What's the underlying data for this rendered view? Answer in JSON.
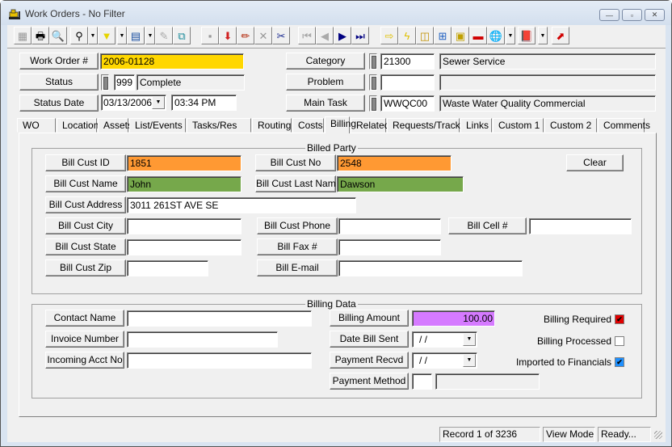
{
  "window": {
    "title": "Work Orders - No Filter",
    "minimize_glyph": "—",
    "maximize_glyph": "▫",
    "close_glyph": "✕"
  },
  "toolbar": {
    "buttons": [
      {
        "name": "blank-view",
        "glyph": "▦",
        "color": "#999999",
        "enabled": false
      },
      {
        "name": "print",
        "glyph": "🖶",
        "color": "#000000",
        "enabled": true
      },
      {
        "name": "print-preview",
        "glyph": "🔍",
        "color": "#000000",
        "enabled": true
      },
      {
        "name": "search",
        "glyph": "⚲",
        "color": "#000000",
        "enabled": true,
        "has_dropdown": true
      },
      {
        "name": "filter",
        "glyph": "▼",
        "color": "#e6d400",
        "enabled": true,
        "has_dropdown": true
      },
      {
        "name": "report",
        "glyph": "▤",
        "color": "#1a4fa0",
        "enabled": true,
        "has_dropdown": true
      },
      {
        "name": "edit-form",
        "glyph": "✎",
        "color": "#aaaaaa",
        "enabled": false
      },
      {
        "name": "copy-document",
        "glyph": "⧉",
        "color": "#1a8a9a",
        "enabled": true
      },
      {
        "name": "save",
        "glyph": "▪",
        "color": "#999999",
        "enabled": false
      },
      {
        "name": "add-record",
        "glyph": "⬇",
        "color": "#d02020",
        "enabled": true
      },
      {
        "name": "edit",
        "glyph": "✏",
        "color": "#b02000",
        "enabled": true
      },
      {
        "name": "delete",
        "glyph": "✕",
        "color": "#999999",
        "enabled": false
      },
      {
        "name": "cut",
        "glyph": "✂",
        "color": "#1a2a90",
        "enabled": true
      },
      {
        "name": "first-record",
        "glyph": "⏮",
        "color": "#aaaaaa",
        "enabled": false
      },
      {
        "name": "previous-record",
        "glyph": "◀",
        "color": "#aaaaaa",
        "enabled": false
      },
      {
        "name": "next-record",
        "glyph": "▶",
        "color": "#000080",
        "enabled": true
      },
      {
        "name": "last-record",
        "glyph": "⏭",
        "color": "#000080",
        "enabled": true
      },
      {
        "name": "go-to",
        "glyph": "⇨",
        "color": "#e0c000",
        "enabled": true
      },
      {
        "name": "quick-action",
        "glyph": "ϟ",
        "color": "#e0c000",
        "enabled": true
      },
      {
        "name": "map",
        "glyph": "◫",
        "color": "#c09000",
        "enabled": true
      },
      {
        "name": "workflow",
        "glyph": "⊞",
        "color": "#2060c0",
        "enabled": true
      },
      {
        "name": "equipment",
        "glyph": "▣",
        "color": "#c0a000",
        "enabled": true
      },
      {
        "name": "toolbox",
        "glyph": "▬",
        "color": "#d00000",
        "enabled": true
      },
      {
        "name": "globe-search",
        "glyph": "🌐",
        "color": "#1a6ab0",
        "enabled": true,
        "has_dropdown": true
      },
      {
        "name": "book",
        "glyph": "📕",
        "color": "#8a3aa0",
        "enabled": true,
        "has_dropdown": true
      },
      {
        "name": "exit",
        "glyph": "⬈",
        "color": "#d00000",
        "enabled": true
      }
    ]
  },
  "header": {
    "work_order": {
      "label": "Work Order #",
      "value": "2006-01128",
      "color": "#ffd700"
    },
    "status": {
      "label": "Status",
      "code": "999",
      "description": "Complete"
    },
    "status_date": {
      "label": "Status Date",
      "date": "03/13/2006",
      "time": "03:34 PM"
    },
    "category": {
      "label": "Category",
      "code": "21300",
      "description": "Sewer Service"
    },
    "problem": {
      "label": "Problem",
      "code": "",
      "description": ""
    },
    "main_task": {
      "label": "Main Task",
      "code": "WWQC00",
      "description": "Waste Water Quality Commercial"
    }
  },
  "tabs": [
    {
      "label": "WO",
      "active": false
    },
    {
      "label": "Location",
      "active": false
    },
    {
      "label": "Assets",
      "active": false
    },
    {
      "label": "List/Events",
      "active": false
    },
    {
      "label": "Tasks/Res",
      "active": false
    },
    {
      "label": "Routing",
      "active": false
    },
    {
      "label": "Costs",
      "active": false
    },
    {
      "label": "Billing",
      "active": true
    },
    {
      "label": "Related",
      "active": false
    },
    {
      "label": "Requests/Track",
      "active": false
    },
    {
      "label": "Links",
      "active": false
    },
    {
      "label": "Custom 1",
      "active": false
    },
    {
      "label": "Custom 2",
      "active": false
    },
    {
      "label": "Comments",
      "active": false
    }
  ],
  "billed_party": {
    "title": "Billed Party",
    "clear_label": "Clear",
    "bill_cust_id": {
      "label": "Bill Cust ID",
      "value": "1851",
      "color": "#ff9933"
    },
    "bill_cust_no": {
      "label": "Bill Cust No",
      "value": "2548",
      "color": "#ff9933"
    },
    "bill_cust_name": {
      "label": "Bill Cust Name",
      "value": "John",
      "color": "#76a84b"
    },
    "bill_cust_last_name": {
      "label": "Bill Cust Last Name",
      "value": "Dawson",
      "color": "#76a84b"
    },
    "bill_cust_address": {
      "label": "Bill Cust Address",
      "value": "3011 261ST AVE SE"
    },
    "bill_cust_city": {
      "label": "Bill Cust City",
      "value": ""
    },
    "bill_cust_state": {
      "label": "Bill Cust State",
      "value": ""
    },
    "bill_cust_zip": {
      "label": "Bill Cust Zip",
      "value": ""
    },
    "bill_cust_phone": {
      "label": "Bill Cust Phone",
      "value": ""
    },
    "bill_fax": {
      "label": "Bill Fax #",
      "value": ""
    },
    "bill_email": {
      "label": "Bill E-mail",
      "value": ""
    },
    "bill_cell": {
      "label": "Bill Cell #",
      "value": ""
    }
  },
  "billing_data": {
    "title": "Billing Data",
    "contact_name": {
      "label": "Contact Name",
      "value": ""
    },
    "invoice_number": {
      "label": "Invoice Number",
      "value": ""
    },
    "incoming_acct_no": {
      "label": "Incoming Acct No",
      "value": ""
    },
    "billing_amount": {
      "label": "Billing Amount",
      "value": "100.00",
      "color": "#d57aff"
    },
    "date_bill_sent": {
      "label": "Date Bill Sent",
      "value": " /  /"
    },
    "payment_recvd": {
      "label": "Payment Recvd",
      "value": " /  /"
    },
    "payment_method": {
      "label": "Payment Method",
      "code": "",
      "description": ""
    },
    "billing_required": {
      "label": "Billing Required",
      "checked": true,
      "color": "#e00000"
    },
    "billing_processed": {
      "label": "Billing Processed",
      "checked": false
    },
    "imported_to_financials": {
      "label": "Imported to Financials",
      "checked": true,
      "color": "#1e90ff"
    }
  },
  "status_bar": {
    "record": "Record 1 of 3236",
    "mode": "View Mode",
    "state": "Ready..."
  },
  "icons": {
    "dropdown": "▼",
    "check": "✔"
  }
}
